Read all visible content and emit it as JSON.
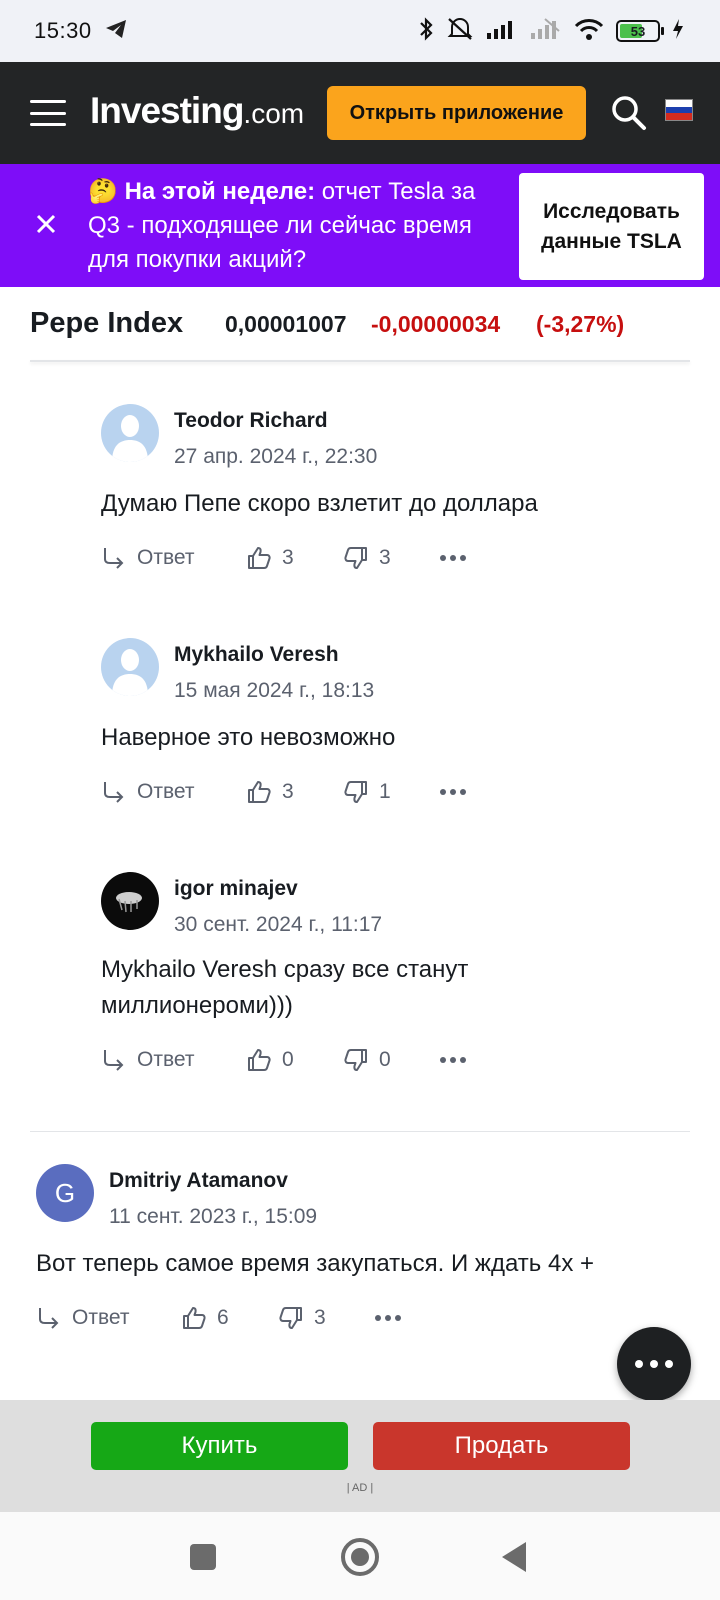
{
  "status_bar": {
    "time": "15:30",
    "battery": "53"
  },
  "header": {
    "logo_main": "Investing",
    "logo_suffix": ".com",
    "open_app_label": "Открыть приложение"
  },
  "promo": {
    "emoji": "🤔",
    "bold": "На этой неделе:",
    "text": " отчет Tesla за Q3 - подходящее ли сейчас время для покупки акций?",
    "cta": "Исследовать данные TSLA"
  },
  "instrument": {
    "name": "Pepe Index",
    "price": "0,00001007",
    "change": "-0,00000034",
    "change_pct": "(-3,27%)"
  },
  "comments": [
    {
      "author": "Teodor Richard",
      "date": "27 апр. 2024 г., 22:30",
      "text": "Думаю Пепе скоро взлетит до доллара",
      "reply": "Ответ",
      "likes": "3",
      "dislikes": "3"
    },
    {
      "author": "Mykhailo Veresh",
      "date": "15 мая 2024 г., 18:13",
      "text": "Наверное это невозможно",
      "reply": "Ответ",
      "likes": "3",
      "dislikes": "1"
    },
    {
      "author": "igor minajev",
      "date": "30 сент. 2024 г., 11:17",
      "text": "Mykhailo Veresh сразу все станут миллионероми)))",
      "reply": "Ответ",
      "likes": "0",
      "dislikes": "0"
    },
    {
      "author": "Dmitriy Atamanov",
      "avatar_letter": "G",
      "date": "11 сент. 2023 г., 15:09",
      "text": "Вот теперь самое время закупаться. И ждать 4х +",
      "reply": "Ответ",
      "likes": "6",
      "dislikes": "3"
    }
  ],
  "ad": {
    "buy_label": "Купить",
    "sell_label": "Продать",
    "ad_label": "| AD |"
  },
  "colors": {
    "header_bg": "#232526",
    "accent_orange": "#fba41c",
    "promo_purple": "#7e0df8",
    "negative_red": "#c60f0f",
    "buy_green": "#16a816",
    "sell_red": "#c9362c"
  }
}
